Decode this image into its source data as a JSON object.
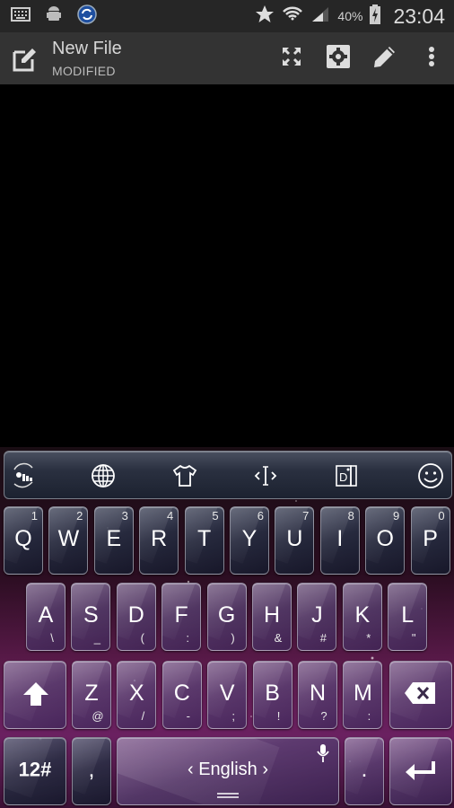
{
  "status_bar": {
    "left_icons": [
      "keyboard-icon",
      "android-icon",
      "sync-icon"
    ],
    "right_icons": [
      "star-icon",
      "wifi-icon",
      "signal-icon",
      "battery-charging-icon"
    ],
    "battery_percent": "40%",
    "time": "23:04"
  },
  "app_bar": {
    "title": "New File",
    "subtitle": "MODIFIED",
    "actions": [
      "fullscreen",
      "settings",
      "edit",
      "more-options"
    ]
  },
  "keyboard": {
    "toolbar": [
      "gesture-typing",
      "language-globe",
      "themes",
      "cursor-control",
      "dictionary",
      "emoji"
    ],
    "row1": [
      {
        "key": "Q",
        "num": "1"
      },
      {
        "key": "W",
        "num": "2"
      },
      {
        "key": "E",
        "num": "3"
      },
      {
        "key": "R",
        "num": "4"
      },
      {
        "key": "T",
        "num": "5"
      },
      {
        "key": "Y",
        "num": "6"
      },
      {
        "key": "U",
        "num": "7"
      },
      {
        "key": "I",
        "num": "8"
      },
      {
        "key": "O",
        "num": "9"
      },
      {
        "key": "P",
        "num": "0"
      }
    ],
    "row2": [
      {
        "key": "A",
        "sec": "\\"
      },
      {
        "key": "S",
        "sec": "_"
      },
      {
        "key": "D",
        "sec": "("
      },
      {
        "key": "F",
        "sec": ":"
      },
      {
        "key": "G",
        "sec": ")"
      },
      {
        "key": "H",
        "sec": "&"
      },
      {
        "key": "J",
        "sec": "#"
      },
      {
        "key": "K",
        "sec": "*"
      },
      {
        "key": "L",
        "sec": "\""
      }
    ],
    "row3": [
      {
        "key": "Z",
        "sec": "@"
      },
      {
        "key": "X",
        "sec": "/"
      },
      {
        "key": "C",
        "sec": "-"
      },
      {
        "key": "V",
        "sec": ";"
      },
      {
        "key": "B",
        "sec": "!"
      },
      {
        "key": "N",
        "sec": "?"
      },
      {
        "key": "M",
        "sec": ":"
      }
    ],
    "symbols_key": "12#",
    "comma_key": ",",
    "space_language": "‹  English  ›",
    "period_key": "."
  }
}
